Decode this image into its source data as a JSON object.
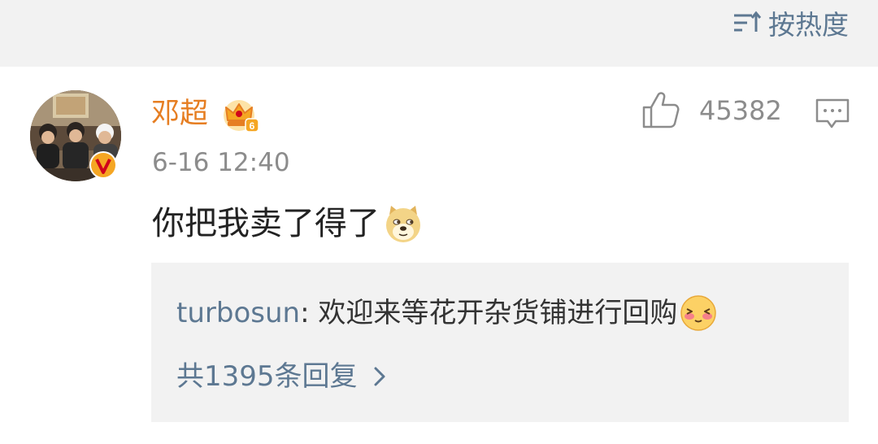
{
  "sort": {
    "label": "按热度",
    "icon": "sort-icon"
  },
  "comment": {
    "author": "邓超",
    "time": "6-16 12:40",
    "text": "你把我卖了得了",
    "like_count": "45382",
    "badges": [
      "crown-badge-icon",
      "verified-v-icon"
    ],
    "emoji": "doge-emoji"
  },
  "reply_preview": {
    "user": "turbosun",
    "separator": ": ",
    "text": "欢迎来等花开杂货铺进行回购",
    "emoji": "shy-emoji"
  },
  "more_replies": {
    "label": "共1395条回复",
    "icon": "chevron-right-icon"
  },
  "colors": {
    "accent": "#5d7892",
    "author": "#e67e22",
    "muted": "#8c8c8c",
    "panel": "#f2f2f2"
  }
}
